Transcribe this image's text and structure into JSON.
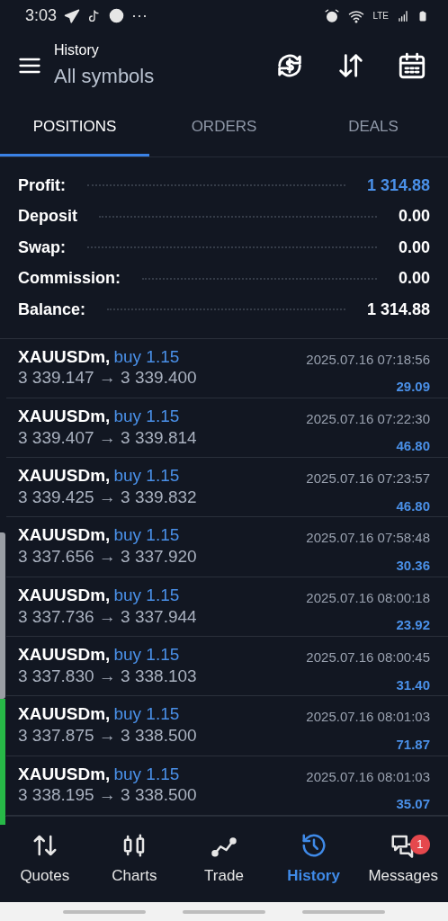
{
  "status_bar": {
    "time": "3:03",
    "more": "···",
    "network": "LTE"
  },
  "header": {
    "title": "History",
    "subtitle": "All symbols"
  },
  "tabs": [
    {
      "label": "POSITIONS",
      "selected": true
    },
    {
      "label": "ORDERS",
      "selected": false
    },
    {
      "label": "DEALS",
      "selected": false
    }
  ],
  "summary": [
    {
      "label": "Profit:",
      "value": "1 314.88",
      "highlight": true
    },
    {
      "label": "Deposit",
      "value": "0.00",
      "highlight": false
    },
    {
      "label": "Swap:",
      "value": "0.00",
      "highlight": false
    },
    {
      "label": "Commission:",
      "value": "0.00",
      "highlight": false
    },
    {
      "label": "Balance:",
      "value": "1 314.88",
      "highlight": false
    }
  ],
  "positions": [
    {
      "symbol": "XAUUSDm,",
      "side": "buy 1.15",
      "prices": "3 339.147 → 3 339.400",
      "time": "2025.07.16 07:18:56",
      "profit": "29.09"
    },
    {
      "symbol": "XAUUSDm,",
      "side": "buy 1.15",
      "prices": "3 339.407 → 3 339.814",
      "time": "2025.07.16 07:22:30",
      "profit": "46.80"
    },
    {
      "symbol": "XAUUSDm,",
      "side": "buy 1.15",
      "prices": "3 339.425 → 3 339.832",
      "time": "2025.07.16 07:23:57",
      "profit": "46.80"
    },
    {
      "symbol": "XAUUSDm,",
      "side": "buy 1.15",
      "prices": "3 337.656 → 3 337.920",
      "time": "2025.07.16 07:58:48",
      "profit": "30.36"
    },
    {
      "symbol": "XAUUSDm,",
      "side": "buy 1.15",
      "prices": "3 337.736 → 3 337.944",
      "time": "2025.07.16 08:00:18",
      "profit": "23.92"
    },
    {
      "symbol": "XAUUSDm,",
      "side": "buy 1.15",
      "prices": "3 337.830 → 3 338.103",
      "time": "2025.07.16 08:00:45",
      "profit": "31.40"
    },
    {
      "symbol": "XAUUSDm,",
      "side": "buy 1.15",
      "prices": "3 337.875 → 3 338.500",
      "time": "2025.07.16 08:01:03",
      "profit": "71.87"
    },
    {
      "symbol": "XAUUSDm,",
      "side": "buy 1.15",
      "prices": "3 338.195 → 3 338.500",
      "time": "2025.07.16 08:01:03",
      "profit": "35.07"
    }
  ],
  "bottom_nav": [
    {
      "label": "Quotes",
      "kind": "quotes",
      "selected": false
    },
    {
      "label": "Charts",
      "kind": "charts",
      "selected": false
    },
    {
      "label": "Trade",
      "kind": "trade",
      "selected": false
    },
    {
      "label": "History",
      "kind": "history",
      "selected": true
    },
    {
      "label": "Messages",
      "kind": "messages",
      "selected": false,
      "badge": "1"
    }
  ]
}
